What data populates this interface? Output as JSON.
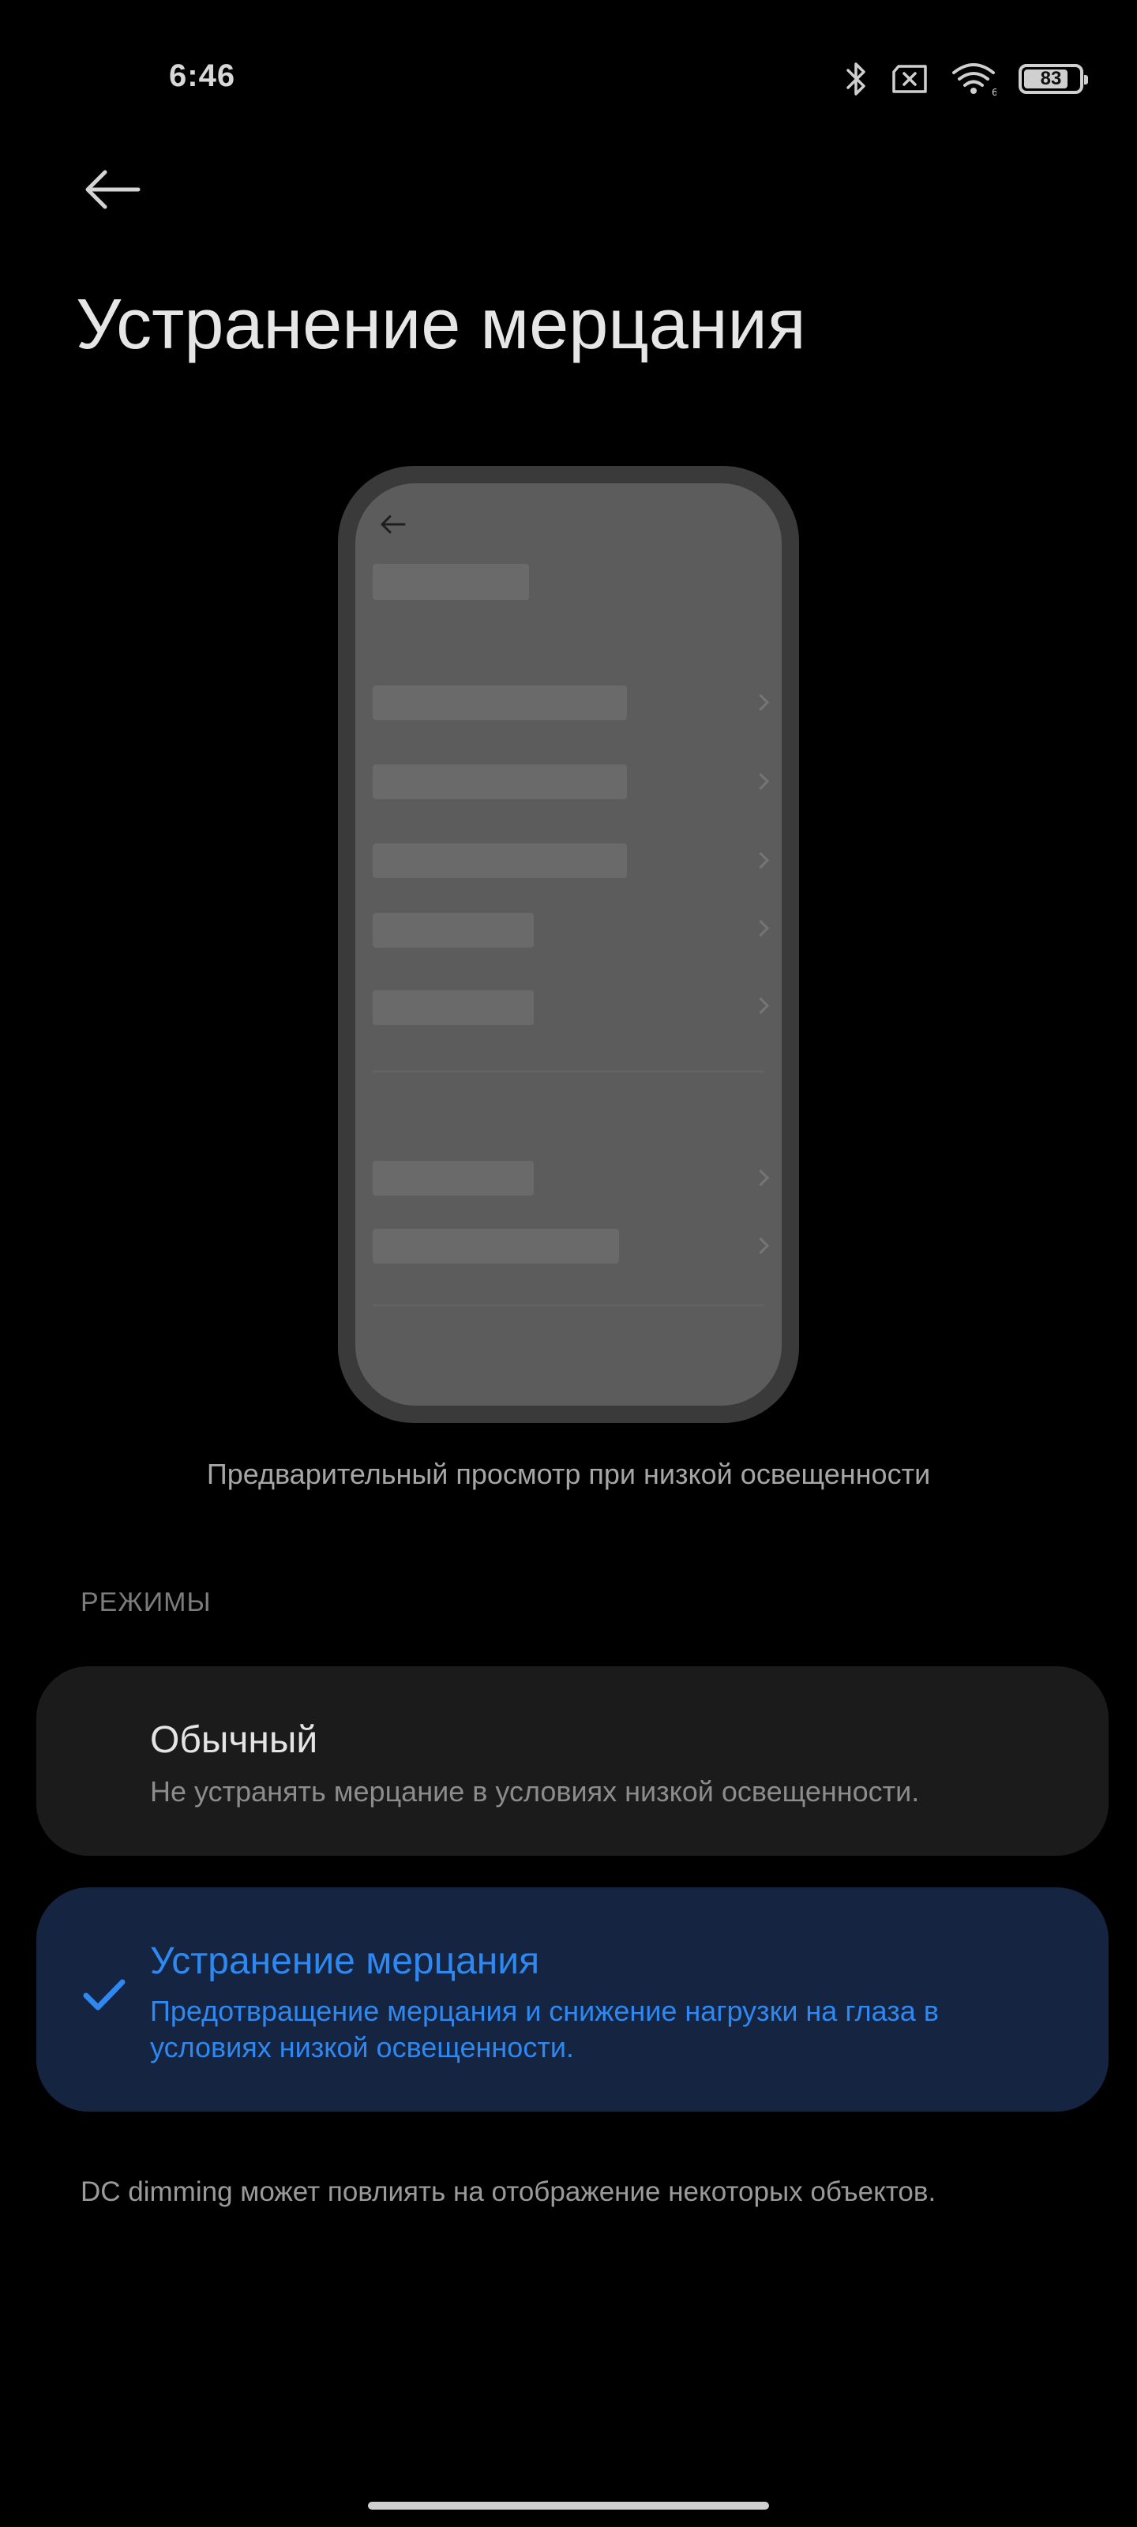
{
  "status_bar": {
    "time": "6:46",
    "battery": "83",
    "battery_level": 0.83,
    "icons": [
      "bluetooth-icon",
      "no-sim-icon",
      "wifi-icon",
      "battery-icon"
    ]
  },
  "header": {
    "title": "Устранение мерцания"
  },
  "preview": {
    "caption": "Предварительный просмотр при низкой освещенности"
  },
  "modes": {
    "section_label": "РЕЖИМЫ",
    "items": [
      {
        "title": "Обычный",
        "description": "Не устранять мерцание в условиях низкой освещенности.",
        "selected": false
      },
      {
        "title": "Устранение мерцания",
        "description": "Предотвращение мерцания и снижение нагрузки на глаза в условиях низкой освещенности.",
        "selected": true
      }
    ]
  },
  "footnote": "DC dimming может повлиять на отображение некоторых объектов.",
  "colors": {
    "background": "#000000",
    "accent": "#2f88f0",
    "selected_card": "#152440",
    "card": "#1b1b1b"
  }
}
